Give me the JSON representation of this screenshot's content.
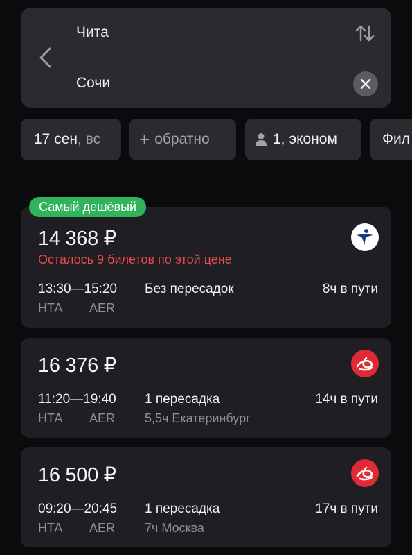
{
  "search": {
    "from": "Чита",
    "to": "Сочи"
  },
  "chips": {
    "date_main": "17 сен",
    "date_weekday": ", вс",
    "return_plus": "+",
    "return_label": "обратно",
    "passengers": "1, эконом",
    "filters": "Фил"
  },
  "badge": "Самый дешёвый",
  "flights": [
    {
      "price": "14 368 ₽",
      "warning": "Осталось 9 билетов по этой цене",
      "depart_time": "13:30",
      "dash": "—",
      "arrive_time": "15:20",
      "from_code": "НТА",
      "to_code": "AER",
      "stops": "Без пересадок",
      "via": "",
      "duration": "8ч в пути",
      "airline_logo": "white-blue-swirl-logo"
    },
    {
      "price": "16 376 ₽",
      "warning": "",
      "depart_time": "11:20",
      "dash": "—",
      "arrive_time": "19:40",
      "from_code": "НТА",
      "to_code": "AER",
      "stops": "1 пересадка",
      "via": "5,5ч Екатеринбург",
      "duration": "14ч в пути",
      "airline_logo": "red-white-swirl-logo"
    },
    {
      "price": "16 500 ₽",
      "warning": "",
      "depart_time": "09:20",
      "dash": "—",
      "arrive_time": "20:45",
      "from_code": "НТА",
      "to_code": "AER",
      "stops": "1 пересадка",
      "via": "7ч Москва",
      "duration": "17ч в пути",
      "airline_logo": "red-white-swirl-logo"
    }
  ],
  "colors": {
    "background": "#0b0b0d",
    "card": "#1f1f23",
    "panel": "#2b2b2f",
    "badge": "#2fb35b",
    "warning": "#e94a4a",
    "muted": "#8f8f95"
  }
}
